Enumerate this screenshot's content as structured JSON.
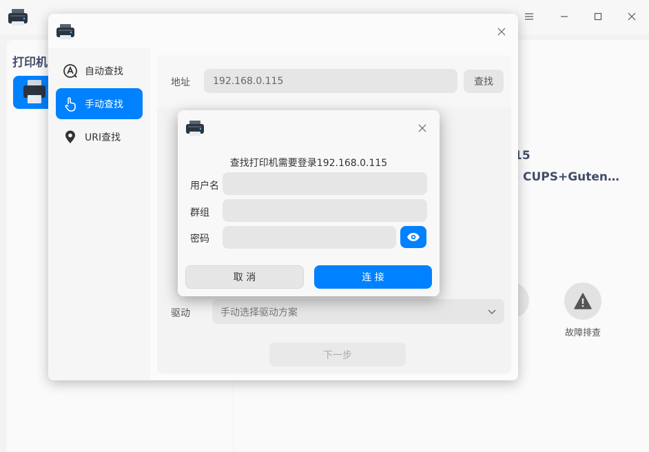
{
  "main": {
    "left_title": "打印机",
    "printer_ip_fragment": "15",
    "printer_driver_fragment": "- CUPS+Guten…",
    "troubleshoot_label": "故障排查"
  },
  "add_dialog": {
    "nav": [
      {
        "label": "自动查找",
        "icon": "auto-find-icon"
      },
      {
        "label": "手动查找",
        "icon": "manual-find-icon",
        "active": true
      },
      {
        "label": "URI查找",
        "icon": "location-pin-icon"
      }
    ],
    "address_label": "地址",
    "address_value": "192.168.0.115",
    "find_button": "查找",
    "driver_label": "驱动",
    "driver_value": "手动选择驱动方案",
    "next_button": "下一步"
  },
  "login_dialog": {
    "message": "查找打印机需要登录192.168.0.115",
    "username_label": "用户名",
    "group_label": "群组",
    "password_label": "密码",
    "username_value": "",
    "group_value": "",
    "password_value": "",
    "cancel_button": "取 消",
    "connect_button": "连 接"
  },
  "colors": {
    "accent": "#0081ff",
    "window_bg": "#f3f3f3",
    "input_bg": "#e6e6e6"
  }
}
